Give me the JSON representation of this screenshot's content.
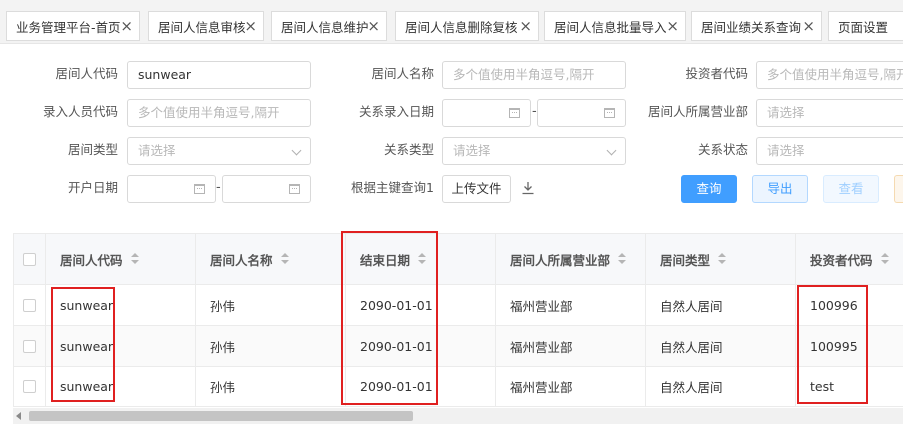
{
  "tabs": [
    {
      "label": "业务管理平台-首页"
    },
    {
      "label": "居间人信息审核"
    },
    {
      "label": "居间人信息维护"
    },
    {
      "label": "居间人信息删除复核"
    },
    {
      "label": "居间人信息批量导入"
    },
    {
      "label": "居间业绩关系查询"
    },
    {
      "label": "页面设置"
    }
  ],
  "close_glyph": "×",
  "form": {
    "agent_code_label": "居间人代码",
    "agent_code_value": "sunwear",
    "agent_name_label": "居间人名称",
    "agent_name_placeholder": "多个值使用半角逗号,隔开",
    "investor_code_label": "投资者代码",
    "investor_code_placeholder": "多个值使用半角逗号,隔开",
    "entry_staff_label": "录入人员代码",
    "entry_staff_placeholder": "多个值使用半角逗号,隔开",
    "relation_date_label": "关系录入日期",
    "agent_branch_label": "居间人所属营业部",
    "agent_branch_placeholder": "请选择",
    "agent_type_label": "居间类型",
    "agent_type_placeholder": "请选择",
    "relation_type_label": "关系类型",
    "relation_type_placeholder": "请选择",
    "relation_status_label": "关系状态",
    "relation_status_placeholder": "请选择",
    "open_date_label": "开户日期",
    "pk_query_label": "根据主键查询1",
    "upload_label": "上传文件",
    "date_separator": "-"
  },
  "buttons": {
    "query": "查询",
    "export": "导出",
    "view": "查看"
  },
  "table": {
    "headers": [
      "居间人代码",
      "居间人名称",
      "结束日期",
      "居间人所属营业部",
      "居间类型",
      "投资者代码"
    ],
    "rows": [
      [
        "sunwear",
        "孙伟",
        "2090-01-01",
        "福州营业部",
        "自然人居间",
        "100996"
      ],
      [
        "sunwear",
        "孙伟",
        "2090-01-01",
        "福州营业部",
        "自然人居间",
        "100995"
      ],
      [
        "sunwear",
        "孙伟",
        "2090-01-01",
        "福州营业部",
        "自然人居间",
        "test"
      ]
    ]
  },
  "colors": {
    "primary": "#409eff",
    "highlight_box": "#e02020"
  }
}
